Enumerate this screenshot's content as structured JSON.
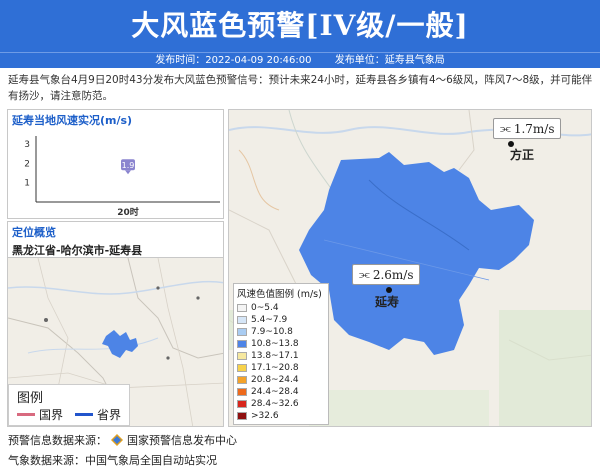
{
  "header": {
    "title": "大风蓝色预警[IV级/一般]",
    "publish_time": "发布时间：2022-04-09 20:46:00",
    "publisher": "发布单位：延寿县气象局"
  },
  "description": "延寿县气象台4月9日20时43分发布大风蓝色预警信号：预计未来24小时，延寿县各乡镇有4～6级风，阵风7～8级，并可能伴有扬沙，请注意防范。",
  "wind_panel": {
    "title": "延寿当地风速实况(m/s)",
    "chart_data": {
      "type": "scatter",
      "categories": [
        "20时"
      ],
      "values": [
        1.9
      ],
      "value_labels": [
        "1.9"
      ],
      "yticks": [
        "1",
        "2",
        "3"
      ],
      "ylim": [
        0,
        3.2
      ],
      "marker_color": "#8a84cf"
    }
  },
  "location_panel": {
    "title": "定位概览",
    "path": "黑龙江省-哈尔滨市-延寿县"
  },
  "mini_map": {
    "legend_title": "图例",
    "legend_items": [
      {
        "label": "国界",
        "color": "#d86a7f"
      },
      {
        "label": "省界",
        "color": "#2255cc"
      }
    ],
    "region_color": "#4d84e6"
  },
  "main_map": {
    "region_color": "#4d84e6",
    "labels": [
      {
        "place": "方正",
        "wind": "1.7m/s"
      },
      {
        "place": "延寿",
        "wind": "2.6m/s"
      }
    ],
    "scale": {
      "title": "风速色值图例 (m/s)",
      "items": [
        {
          "label": "0~5.4",
          "color": "#f4f4f4"
        },
        {
          "label": "5.4~7.9",
          "color": "#d6e6f7"
        },
        {
          "label": "7.9~10.8",
          "color": "#a9ccf2"
        },
        {
          "label": "10.8~13.8",
          "color": "#4d84e6"
        },
        {
          "label": "13.8~17.1",
          "color": "#f6e8a0"
        },
        {
          "label": "17.1~20.8",
          "color": "#f7d24a"
        },
        {
          "label": "20.8~24.4",
          "color": "#f4a22a"
        },
        {
          "label": "24.4~28.4",
          "color": "#ee6a1c"
        },
        {
          "label": "28.4~32.6",
          "color": "#d8261c"
        },
        {
          "label": ">32.6",
          "color": "#8e0f0f"
        }
      ]
    }
  },
  "footer": {
    "warning_source_label": "预警信息数据来源：",
    "warning_source": "国家预警信息发布中心",
    "weather_source": "气象数据来源：中国气象局全国自动站实况"
  }
}
